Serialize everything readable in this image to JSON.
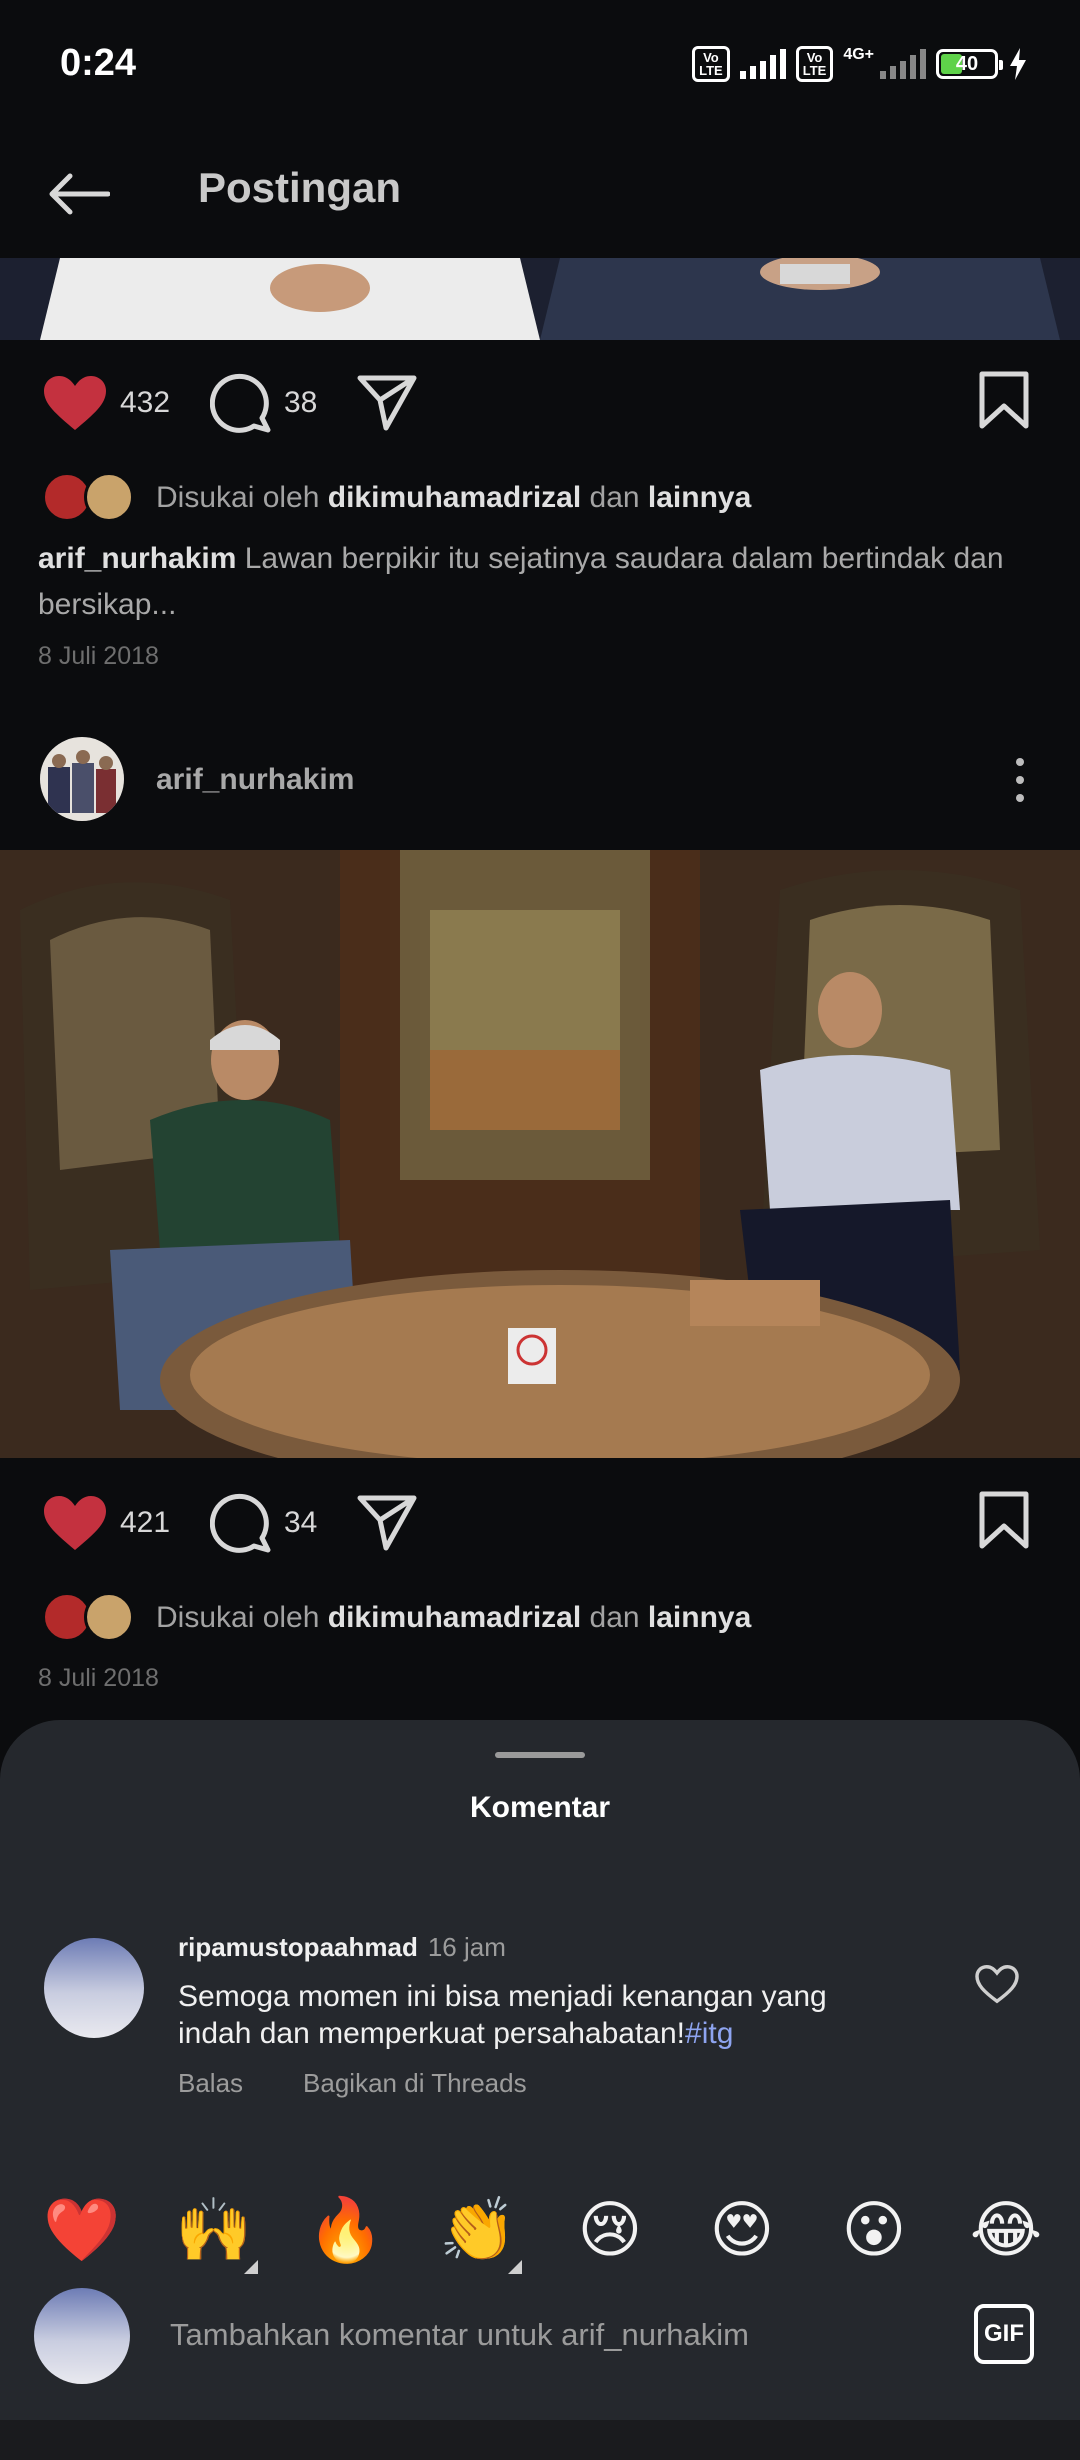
{
  "status_bar": {
    "time": "0:24",
    "volte1": "Vo LTE",
    "volte2": "Vo LTE",
    "network": "4G+",
    "battery": "40"
  },
  "header": {
    "title": "Postingan"
  },
  "post1": {
    "likes": "432",
    "comments": "38",
    "liked_by_prefix": "Disukai oleh ",
    "liked_by_user": "dikimuhamadrizal",
    "liked_by_mid": " dan ",
    "liked_by_others": "lainnya",
    "caption_user": "arif_nurhakim",
    "caption_text": " Lawan berpikir itu sejatinya saudara dalam bertindak dan bersikap...",
    "date": "8 Juli 2018"
  },
  "post2": {
    "username": "arif_nurhakim",
    "likes": "421",
    "comments": "34",
    "liked_by_prefix": "Disukai oleh ",
    "liked_by_user": "dikimuhamadrizal",
    "liked_by_mid": " dan ",
    "liked_by_others": "lainnya",
    "date": "8 Juli 2018"
  },
  "comments_sheet": {
    "title": "Komentar",
    "comment": {
      "user": "ripamustopaahmad",
      "time": "16 jam",
      "text": "Semoga momen ini bisa menjadi kenangan yang indah dan memperkuat persahabatan!",
      "hashtag": "#itg",
      "reply": "Balas",
      "share": "Bagikan di Threads"
    },
    "emojis": [
      "❤️",
      "🙌",
      "🔥",
      "👏",
      "😢",
      "😍",
      "😮",
      "😂"
    ],
    "input_placeholder": "Tambahkan komentar untuk arif_nurhakim",
    "gif_label": "GIF"
  },
  "colors": {
    "background": "#0b0c0e",
    "sheet": "#25282d",
    "like_red": "#c4313f",
    "hashtag": "#8ea4f0"
  }
}
